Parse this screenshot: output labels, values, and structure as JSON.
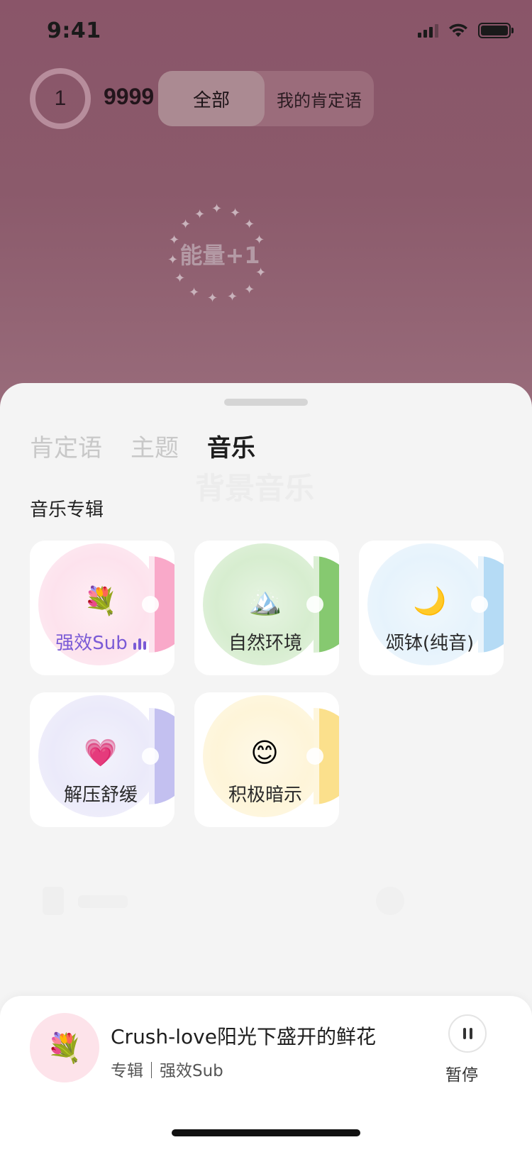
{
  "status_bar": {
    "time": "9:41"
  },
  "header": {
    "count": "1",
    "score": "9999",
    "segments": [
      "全部",
      "我的肯定语"
    ]
  },
  "energy": {
    "text": "能量+1"
  },
  "sheet": {
    "tabs": [
      "肯定语",
      "主题",
      "音乐"
    ],
    "active_tab": "音乐",
    "ghost_title": "背景音乐",
    "section_title": "音乐专辑",
    "albums": [
      {
        "label": "强效Sub",
        "emoji": "💐",
        "playing": true,
        "color": "#f9a9c9"
      },
      {
        "label": "自然环境",
        "emoji": "🏔️",
        "playing": false,
        "color": "#86c970"
      },
      {
        "label": "颂钵(纯音)",
        "emoji": "🌙",
        "playing": false,
        "color": "#b5dbf5"
      },
      {
        "label": "解压舒缓",
        "emoji": "💗",
        "playing": false,
        "color": "#c3c0f0"
      },
      {
        "label": "积极暗示",
        "emoji": "😊",
        "playing": false,
        "color": "#fbe08c"
      }
    ]
  },
  "player": {
    "cover_emoji": "💐",
    "title": "Crush-love阳光下盛开的鲜花",
    "subtitle": "专辑｜强效Sub",
    "pause_label": "暂停"
  }
}
